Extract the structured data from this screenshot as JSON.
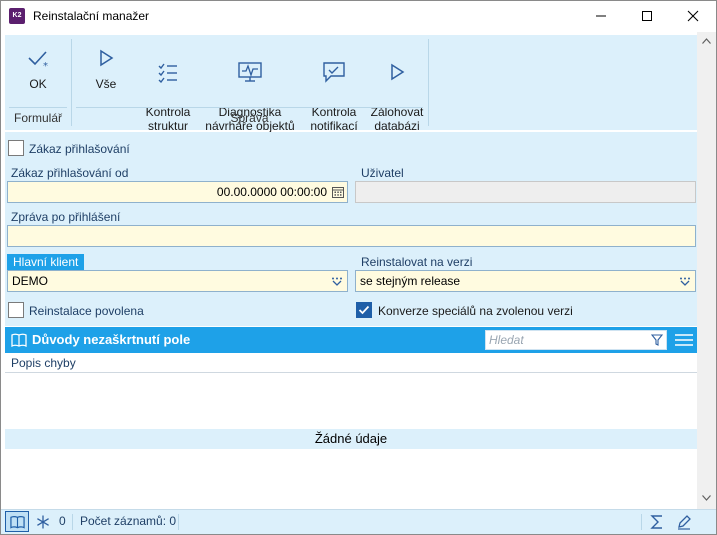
{
  "window": {
    "title": "Reinstalační manažer",
    "app_icon": "K2"
  },
  "ribbon": {
    "groups": [
      {
        "label": "Formulář",
        "buttons": [
          {
            "label": "OK"
          }
        ]
      },
      {
        "label": "Správa",
        "buttons": [
          {
            "label": "Vše"
          },
          {
            "label": "Kontrola\nstruktur"
          },
          {
            "label": "Diagnostika\nnávrháře objektů"
          },
          {
            "label": "Kontrola\nnotifikací"
          },
          {
            "label": "Zálohovat\ndatabázi"
          }
        ]
      }
    ]
  },
  "form": {
    "login_ban_label": "Zákaz přihlašování",
    "login_ban_checked": false,
    "login_ban_from_label": "Zákaz přihlašování od",
    "login_ban_from_value": "00.00.0000 00:00:00",
    "user_label": "Uživatel",
    "user_value": "",
    "message_label": "Zpráva po přihlášení",
    "message_value": "",
    "main_client_label": "Hlavní klient",
    "main_client_value": "DEMO",
    "reinstall_version_label": "Reinstalovat na verzi",
    "reinstall_version_value": "se stejným release",
    "reinstall_allowed_label": "Reinstalace povolena",
    "reinstall_allowed_checked": false,
    "convert_specials_label": "Konverze speciálů na zvolenou verzi",
    "convert_specials_checked": true
  },
  "grid": {
    "title": "Důvody nezaškrtnutí pole",
    "search_placeholder": "Hledat",
    "columns": [
      "Popis chyby"
    ],
    "empty_text": "Žádné údaje"
  },
  "statusbar": {
    "snowflake_count": "0",
    "record_count": "Počet záznamů: 0"
  },
  "colors": {
    "accent": "#1ea1e8",
    "panel": "#dcf0fb",
    "field": "#fffbe0",
    "check": "#1f5fa8"
  }
}
